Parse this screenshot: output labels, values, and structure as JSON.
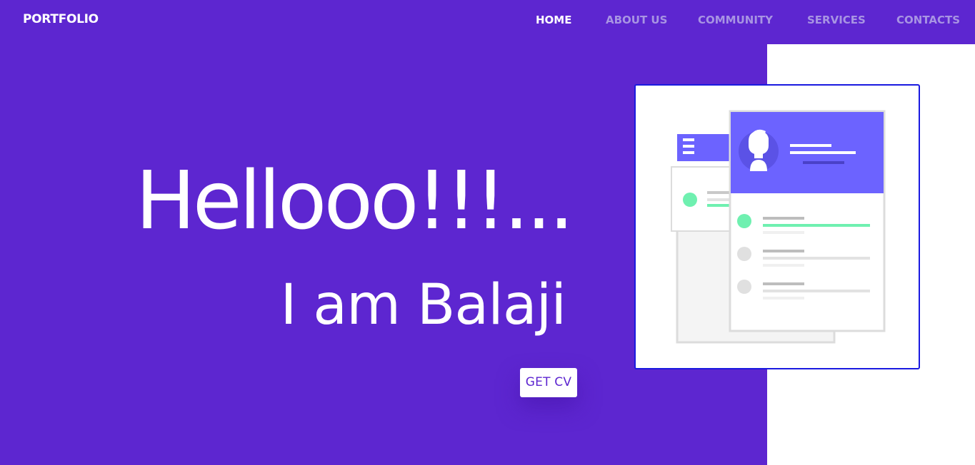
{
  "navbar": {
    "logo": "PORTFOLIO",
    "links": [
      {
        "label": "HOME",
        "active": true
      },
      {
        "label": "ABOUT US",
        "active": false
      },
      {
        "label": "COMMUNITY",
        "active": false
      },
      {
        "label": "SERVICES",
        "active": false
      },
      {
        "label": "CONTACTS",
        "active": false
      }
    ]
  },
  "hero": {
    "greeting": "Hellooo!!!...",
    "intro": "I am Balaji",
    "cv_button_label": "GET CV"
  },
  "illustration": {
    "icon": "profile-resume-illustration"
  },
  "colors": {
    "primary": "#5d26d0",
    "nav_inactive": "#a894e3",
    "card_header": "#6c63ff",
    "accent_green": "#6ff0b0",
    "card_border": "#1a1ae0"
  }
}
